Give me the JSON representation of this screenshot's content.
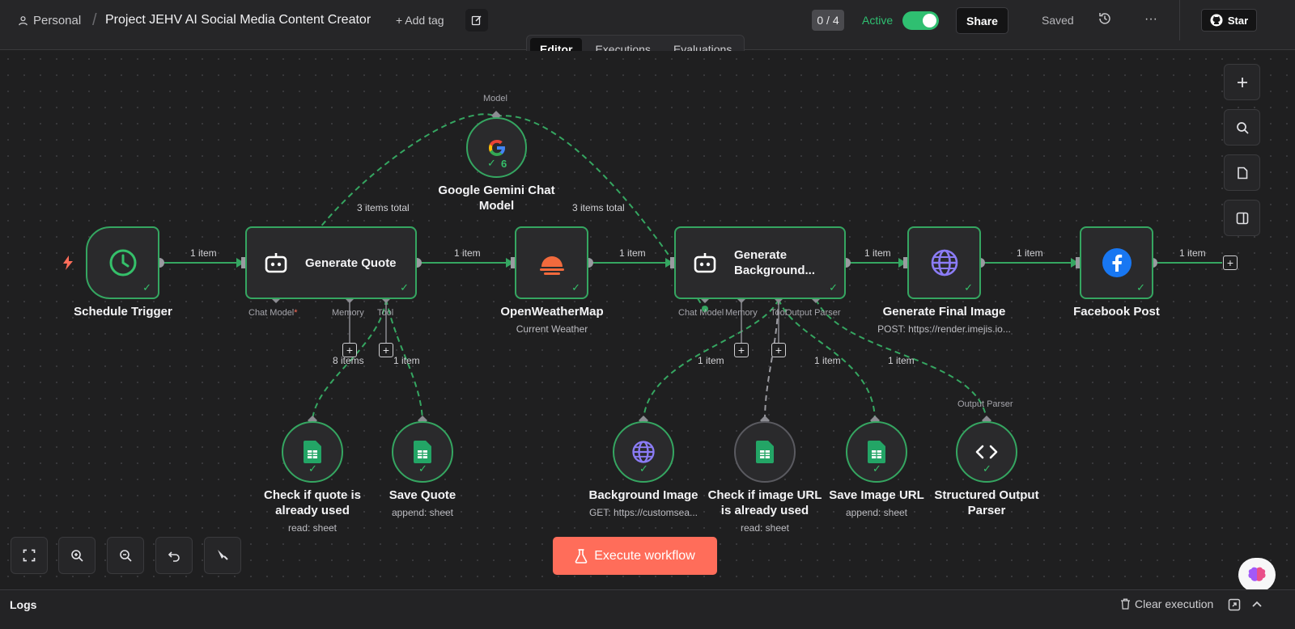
{
  "header": {
    "personal_label": "Personal",
    "separator": "/",
    "project_title": "Project JEHV AI Social Media Content Creator",
    "add_tag_label": "+ Add tag",
    "counter": "0 / 4",
    "active_label": "Active",
    "share_label": "Share",
    "saved_label": "Saved",
    "more_label": "···",
    "star_label": "Star"
  },
  "tabs": [
    {
      "label": "Editor",
      "selected": true
    },
    {
      "label": "Executions",
      "selected": false
    },
    {
      "label": "Evaluations",
      "selected": false
    }
  ],
  "nodes": {
    "schedule_trigger": {
      "title": "Schedule Trigger"
    },
    "generate_quote": {
      "title": "Generate Quote",
      "ports": [
        "Chat Model",
        "Memory",
        "Tool"
      ],
      "required_mark": "*"
    },
    "gemini": {
      "title": "Google Gemini Chat Model",
      "port": "Model",
      "count": "6"
    },
    "openweathermap": {
      "title": "OpenWeatherMap",
      "subtitle": "Current Weather"
    },
    "generate_background": {
      "title": "Generate Background...",
      "ports": [
        "Chat Model",
        "Memory",
        "Tool",
        "Output Parser"
      ]
    },
    "generate_final_image": {
      "title": "Generate Final Image",
      "subtitle": "POST: https://render.imejis.io..."
    },
    "facebook_post": {
      "title": "Facebook Post"
    },
    "check_quote": {
      "title": "Check if quote is already used",
      "subtitle": "read: sheet"
    },
    "save_quote": {
      "title": "Save Quote",
      "subtitle": "append: sheet"
    },
    "background_image": {
      "title": "Background Image",
      "subtitle": "GET: https://customsea..."
    },
    "check_image_url": {
      "title": "Check if image URL is already used",
      "subtitle": "read: sheet"
    },
    "save_image_url": {
      "title": "Save Image URL",
      "subtitle": "append: sheet"
    },
    "structured_output_parser": {
      "title": "Structured Output Parser",
      "port": "Output Parser"
    }
  },
  "edge_labels": {
    "trigger_to_quote": "1 item",
    "quote_to_weather": "1 item",
    "weather_to_background": "1 item",
    "background_to_final": "1 item",
    "final_to_facebook": "1 item",
    "facebook_out": "1 item",
    "gemini_left_total": "3 items total",
    "gemini_right_total": "3 items total",
    "quote_tool_a": "8 items",
    "quote_tool_b": "1 item",
    "bg_tool_1": "1 item",
    "bg_tool_2": "1 item",
    "bg_tool_3": "1 item"
  },
  "execute_label": "Execute workflow",
  "logs": {
    "title": "Logs",
    "clear_label": "Clear execution"
  },
  "colors": {
    "success_green": "#35a661",
    "accent_orange": "#ff6d5a",
    "active_green": "#2fbf71"
  },
  "icons": [
    "user-icon",
    "edit-icon",
    "history-icon",
    "github-icon",
    "clock-icon",
    "robot-icon",
    "google-icon",
    "weather-icon",
    "globe-icon",
    "facebook-icon",
    "sheets-icon",
    "code-icon",
    "plus-icon",
    "search-icon",
    "sticky-note-icon",
    "panel-icon",
    "fit-view-icon",
    "zoom-in-icon",
    "zoom-out-icon",
    "undo-icon",
    "clean-icon",
    "flask-icon",
    "brain-icon",
    "trash-icon"
  ]
}
